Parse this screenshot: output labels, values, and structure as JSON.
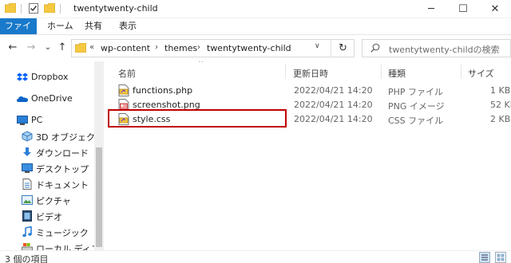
{
  "window": {
    "title": "twentytwenty-child",
    "minimize": "─",
    "maximize": "☐",
    "close": "✕"
  },
  "ribbon": {
    "tabs": [
      "ファイル",
      "ホーム",
      "共有",
      "表示"
    ]
  },
  "nav": {
    "back": "←",
    "forward": "→",
    "recent": "⌄",
    "up": "↑"
  },
  "address": {
    "overflow": "«",
    "parts": [
      "wp-content",
      "themes",
      "twentytwenty-child"
    ],
    "separator": "›",
    "dropdown": "∨",
    "refresh": "↻"
  },
  "search": {
    "placeholder": "twentytwenty-childの検索"
  },
  "sidebar": {
    "items": [
      {
        "label": "Dropbox",
        "icon": "dropbox-icon"
      },
      {
        "label": "OneDrive",
        "icon": "onedrive-icon"
      },
      {
        "label": "PC",
        "icon": "pc-icon"
      },
      {
        "label": "3D オブジェクト",
        "icon": "3d-objects-icon"
      },
      {
        "label": "ダウンロード",
        "icon": "download-icon"
      },
      {
        "label": "デスクトップ",
        "icon": "desktop-icon"
      },
      {
        "label": "ドキュメント",
        "icon": "documents-icon"
      },
      {
        "label": "ピクチャ",
        "icon": "pictures-icon"
      },
      {
        "label": "ビデオ",
        "icon": "video-icon"
      },
      {
        "label": "ミュージック",
        "icon": "music-icon"
      },
      {
        "label": "ローカル ディスク (C",
        "icon": "local-disk-icon"
      }
    ]
  },
  "columns": {
    "sort_indicator": "^",
    "name": "名前",
    "date": "更新日時",
    "type": "種類",
    "size": "サイズ"
  },
  "files": [
    {
      "name": "functions.php",
      "date": "2022/04/21 14:20",
      "type": "PHP ファイル",
      "size": "1 KB"
    },
    {
      "name": "screenshot.png",
      "date": "2022/04/21 14:20",
      "type": "PNG イメージ",
      "size": "52 KB"
    },
    {
      "name": "style.css",
      "date": "2022/04/21 14:20",
      "type": "CSS ファイル",
      "size": "2 KB"
    }
  ],
  "status": {
    "item_count": "3 個の項目"
  },
  "colors": {
    "file_tab_bg": "#1979ca",
    "highlight_border": "#c00000",
    "folder_yellow": "#f5c842"
  }
}
